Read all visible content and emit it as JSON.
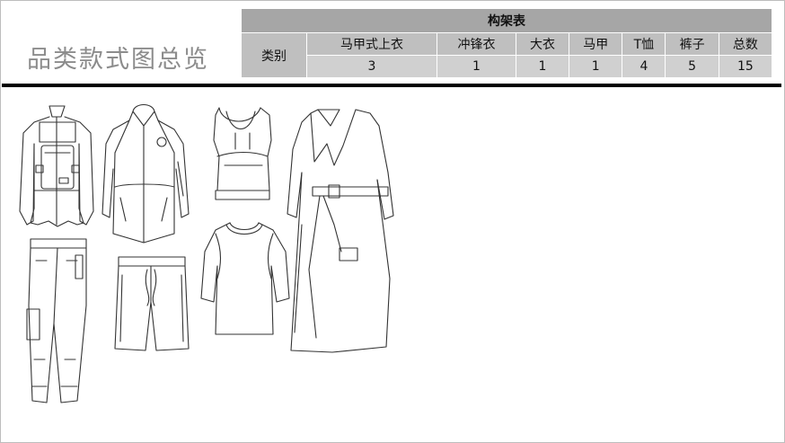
{
  "page_title": "品类款式图总览",
  "frame_table": {
    "title": "构架表",
    "row_label": "类别",
    "columns": [
      "马甲式上衣",
      "冲锋衣",
      "大衣",
      "马甲",
      "T恤",
      "裤子",
      "总数"
    ],
    "counts": [
      "3",
      "1",
      "1",
      "1",
      "4",
      "5",
      "15"
    ]
  },
  "garment_sketches": [
    {
      "icon": "jacket-with-vest-sketch-icon"
    },
    {
      "icon": "hooded-parka-sketch-icon"
    },
    {
      "icon": "cropped-vest-top-sketch-icon"
    },
    {
      "icon": "long-coat-sketch-icon"
    },
    {
      "icon": "cargo-trousers-sketch-icon"
    },
    {
      "icon": "shorts-sketch-icon"
    },
    {
      "icon": "t-shirt-sketch-icon"
    }
  ]
}
